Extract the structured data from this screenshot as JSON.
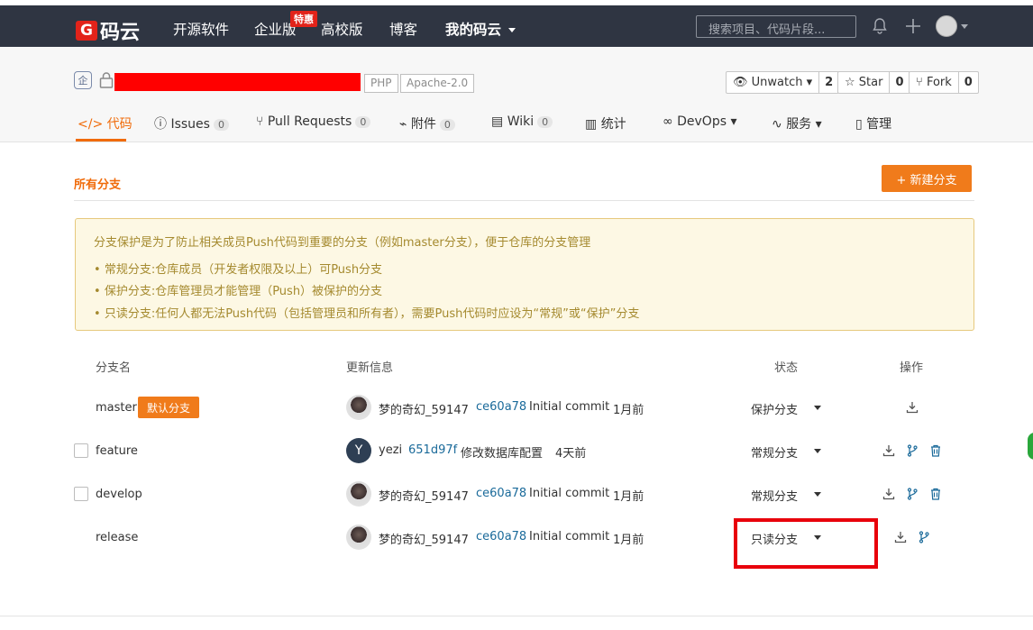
{
  "topnav": {
    "logo_mark": "G",
    "logo_text": "码云",
    "items": [
      "开源软件",
      "企业版",
      "高校版",
      "博客",
      "我的码云"
    ],
    "hot_badge": "特惠",
    "search_placeholder": "搜索项目、代码片段..."
  },
  "repo": {
    "enterprise_icon": "企",
    "tags": [
      "PHP",
      "Apache-2.0"
    ],
    "watch": {
      "label": "Unwatch",
      "count": "2"
    },
    "star": {
      "label": "Star",
      "count": "0"
    },
    "fork": {
      "label": "Fork",
      "count": "0"
    }
  },
  "tabs": [
    {
      "label": "代码"
    },
    {
      "label": "Issues",
      "count": "0"
    },
    {
      "label": "Pull Requests",
      "count": "0"
    },
    {
      "label": "附件",
      "count": "0"
    },
    {
      "label": "Wiki",
      "count": "0"
    },
    {
      "label": "统计"
    },
    {
      "label": "DevOps"
    },
    {
      "label": "服务"
    },
    {
      "label": "管理"
    }
  ],
  "section": {
    "title": "所有分支",
    "new_branch": "+ 新建分支"
  },
  "notice": {
    "title": "分支保护是为了防止相关成员Push代码到重要的分支（例如master分支），便于仓库的分支管理",
    "items": [
      "常规分支:仓库成员（开发者权限及以上）可Push分支",
      "保护分支:仓库管理员才能管理（Push）被保护的分支",
      "只读分支:任何人都无法Push代码（包括管理员和所有者），需要Push代码时应设为“常规”或“保护”分支"
    ]
  },
  "table": {
    "headers": {
      "name": "分支名",
      "update": "更新信息",
      "status": "状态",
      "ops": "操作"
    },
    "default_badge": "默认分支",
    "rows": [
      {
        "name": "master",
        "author": "梦的奇幻_59147",
        "sha": "ce60a78",
        "message": "Initial commit",
        "time": "1月前",
        "status": "保护分支"
      },
      {
        "name": "feature",
        "author": "yezi",
        "avatar_letter": "Y",
        "sha": "651d97f",
        "message": "修改数据库配置",
        "time": "4天前",
        "status": "常规分支"
      },
      {
        "name": "develop",
        "author": "梦的奇幻_59147",
        "sha": "ce60a78",
        "message": "Initial commit",
        "time": "1月前",
        "status": "常规分支"
      },
      {
        "name": "release",
        "author": "梦的奇幻_59147",
        "sha": "ce60a78",
        "message": "Initial commit",
        "time": "1月前",
        "status": "只读分支"
      }
    ]
  },
  "colors": {
    "accent": "#f06b0a",
    "topbar": "#2f3542",
    "highlight": "#e8000b"
  }
}
